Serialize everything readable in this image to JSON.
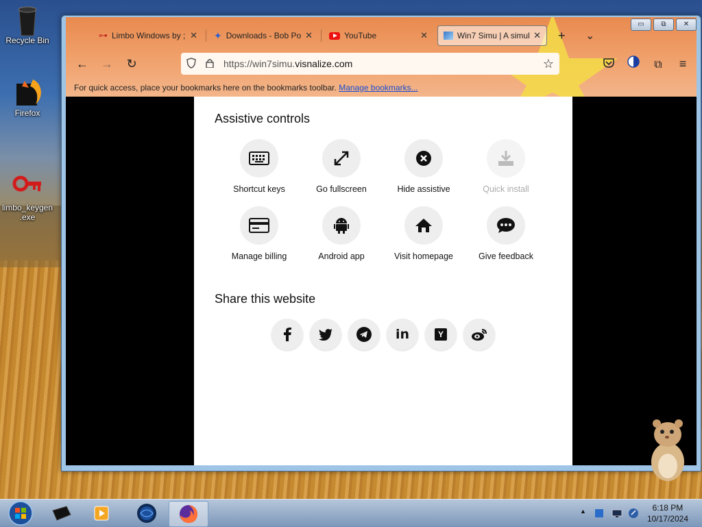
{
  "desktop": {
    "icons": [
      {
        "label": "Recycle Bin",
        "icon": "recycle-bin-icon"
      },
      {
        "label": "Firefox",
        "icon": "firefox-icon"
      },
      {
        "label": "limbo_keygen\n.exe",
        "icon": "key-icon"
      }
    ]
  },
  "browser": {
    "tabs": [
      {
        "title": "Limbo Windows by ;",
        "icon": "key-icon",
        "active": false
      },
      {
        "title": "Downloads - Bob Po",
        "icon": "puzzle-icon",
        "active": false
      },
      {
        "title": "YouTube",
        "icon": "youtube-icon",
        "active": false
      },
      {
        "title": "Win7 Simu | A simul",
        "icon": "win7simu-icon",
        "active": true
      }
    ],
    "new_tab": "+",
    "tab_list": "⌄",
    "url_prefix": "https://win7simu.",
    "url_domain": "visnalize.com",
    "bookmarks_text": "For quick access, place your bookmarks here on the bookmarks toolbar.",
    "bookmarks_link": "Manage bookmarks..."
  },
  "page": {
    "assistive_title": "Assistive controls",
    "controls": [
      {
        "label": "Shortcut keys",
        "icon": "keyboard-icon",
        "enabled": true
      },
      {
        "label": "Go fullscreen",
        "icon": "fullscreen-icon",
        "enabled": true
      },
      {
        "label": "Hide assistive",
        "icon": "close-circle-icon",
        "enabled": true
      },
      {
        "label": "Quick install",
        "icon": "download-icon",
        "enabled": false
      },
      {
        "label": "Manage billing",
        "icon": "credit-card-icon",
        "enabled": true
      },
      {
        "label": "Android app",
        "icon": "android-icon",
        "enabled": true
      },
      {
        "label": "Visit homepage",
        "icon": "home-icon",
        "enabled": true
      },
      {
        "label": "Give feedback",
        "icon": "chat-icon",
        "enabled": true
      }
    ],
    "share_title": "Share this website",
    "share": [
      "facebook-icon",
      "twitter-icon",
      "telegram-icon",
      "linkedin-icon",
      "ycombinator-icon",
      "weibo-icon"
    ]
  },
  "taskbar": {
    "time": "6:18 PM",
    "date": "10/17/2024"
  }
}
